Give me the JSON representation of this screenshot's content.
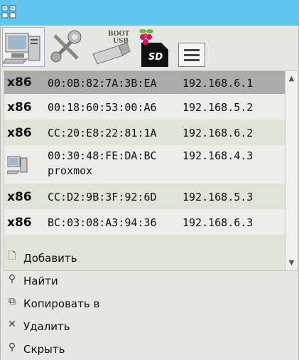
{
  "toolbar": {
    "tools": [
      {
        "name": "computer-icon",
        "selected": true
      },
      {
        "name": "settings-tools-icon",
        "selected": false
      },
      {
        "name": "boot-usb-icon",
        "selected": false,
        "caption": "BOOT USB"
      },
      {
        "name": "raspberry-sd-icon",
        "selected": false,
        "caption": "SD"
      },
      {
        "name": "menu-icon",
        "selected": false
      }
    ]
  },
  "devices": [
    {
      "arch": "x86",
      "mac": "00:0B:82:7A:3B:EA",
      "ip": "192.168.6.1",
      "selected": true
    },
    {
      "arch": "x86",
      "mac": "00:18:60:53:00:A6",
      "ip": "192.168.5.2"
    },
    {
      "arch": "x86",
      "mac": "CC:20:E8:22:81:1A",
      "ip": "192.168.6.2"
    },
    {
      "arch": "",
      "mac": "00:30:48:FE:DA:BC",
      "ip": "192.168.4.3",
      "hostname": "proxmox",
      "icon": "computer-icon"
    },
    {
      "arch": "x86",
      "mac": "CC:D2:9B:3F:92:6D",
      "ip": "192.168.5.3"
    },
    {
      "arch": "x86",
      "mac": "BC:03:08:A3:94:36",
      "ip": "192.168.6.3"
    }
  ],
  "actions": [
    {
      "label": "Добавить",
      "icon": "add-file-icon"
    },
    {
      "label": "Найти",
      "icon": "search-icon"
    },
    {
      "label": "Копировать в",
      "icon": "copy-icon"
    },
    {
      "label": "Удалить",
      "icon": "close-icon"
    },
    {
      "label": "Скрыть",
      "icon": "hide-icon"
    }
  ],
  "colors": {
    "titlebar": "#61c6ee",
    "selected_row": "#ababab",
    "row_alt": "#dfe3d8",
    "row_plain": "#ececea"
  }
}
